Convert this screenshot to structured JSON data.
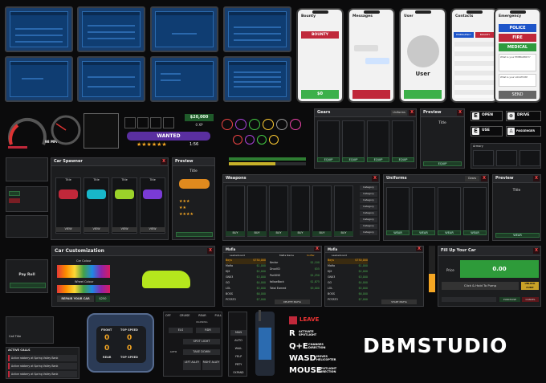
{
  "brand": "DBMSTUDIO",
  "phones": [
    {
      "title": "Bounty",
      "button": "BOUNTY",
      "amount": "$0"
    },
    {
      "title": "Messages"
    },
    {
      "title": "User",
      "name": "User"
    },
    {
      "title": "Contacts",
      "badges": [
        "EMERGENCY",
        "BOUNTY"
      ]
    },
    {
      "title": "Emergency",
      "buttons": [
        "POLICE",
        "FIRE",
        "MEDICAL"
      ],
      "input": "What is your EMERGENCY?",
      "location": "What is your LOCATION?",
      "send": "SEND"
    }
  ],
  "hud": {
    "speed": "98 MPH",
    "money": "$20,000",
    "xp": "0 XP",
    "wanted": "WANTED",
    "timer": "1:56"
  },
  "gears": {
    "title": "Gears",
    "uniform_btn": "Uniforms",
    "equip": [
      "EQUIP",
      "EQUIP",
      "EQUIP",
      "EQUIP"
    ]
  },
  "preview1": {
    "title": "Preview",
    "subtitle": "Title",
    "equip": "EQUIP"
  },
  "keys": [
    {
      "key": "E",
      "label": "OPEN"
    },
    {
      "key": "E",
      "label": "USE"
    },
    {
      "label": "DRIVE"
    },
    {
      "label": "PASSENGER"
    }
  ],
  "armory": {
    "title": "Armory"
  },
  "car_spawner": {
    "title": "Car Spawner",
    "cars": [
      "Title",
      "Title",
      "Title",
      "Title"
    ],
    "view": [
      "VIEW",
      "VIEW",
      "VIEW",
      "VIEW"
    ]
  },
  "preview2": {
    "title": "Preview",
    "subtitle": "Title"
  },
  "weapons": {
    "title": "Weapons",
    "buy": [
      "BUY",
      "BUY",
      "BUY",
      "BUY",
      "BUY",
      "BUY"
    ],
    "category": [
      "Category",
      "Category",
      "Category",
      "Category",
      "Category",
      "Category",
      "Category",
      "Category"
    ]
  },
  "uniforms": {
    "title": "Uniforms",
    "gears_btn": "Gears",
    "wear": [
      "WEAR",
      "WEAR",
      "WEAR",
      "WEAR"
    ]
  },
  "preview3": {
    "title": "Preview",
    "subtitle": "Title",
    "wear": "WEAR"
  },
  "car_custom": {
    "title": "Car Customization",
    "color_picker": "Car Colour",
    "wheel_color": "Wheel Colour",
    "repair": "REPAIR YOUR CAR",
    "price": "$250"
  },
  "mafia": {
    "title": "Mafia",
    "leaderboard": "Leaderboard",
    "name_label": "Mafia Name",
    "sniffer": "Sniffer",
    "rows": [
      [
        "Boys",
        "$750,000"
      ],
      [
        "Mafia",
        "$1,000"
      ],
      [
        "KJX",
        "$2,000"
      ],
      [
        "GNX3",
        "$3,000"
      ],
      [
        "GO",
        "$4,000"
      ],
      [
        "LOL",
        "$5,000"
      ],
      [
        "BOSS",
        "$6,000"
      ],
      [
        "POTATO",
        "$7,000"
      ]
    ],
    "members": [
      [
        "Kevlar",
        "$1,100"
      ],
      [
        "DruxVD",
        "$55"
      ],
      [
        "ParlXNS",
        "$1,250"
      ],
      [
        "fallowBack",
        "$1,875"
      ]
    ],
    "total": "Total Earned",
    "total_val": "$5,000",
    "delete": "DELETE MAFIA",
    "start": "START MAFIA"
  },
  "fuel": {
    "title": "Fill Up Your Car",
    "price_label": "Price",
    "price": "0.00",
    "hold": "Click & Hold To Pump",
    "unlock": "UNLOCK PUMP",
    "purchase": "PURCHASE",
    "cancel": "CANCEL"
  },
  "car_hud": {
    "front": "FRONT",
    "rear": "REAR",
    "top_speed": "TOP SPEED",
    "vals": [
      "0",
      "0",
      "0",
      "0"
    ]
  },
  "siren": {
    "modes": [
      "OFF",
      "CRUISE",
      "REAR",
      "FULL"
    ],
    "warning": "WARNING",
    "els": "ELS",
    "rdr": "RDR",
    "spot": "SPOT LIGHT",
    "take": "TAKE DOWN",
    "left": "LEFT ALLEY",
    "right": "RIGHT ALLEY",
    "auto": "AUTO",
    "side": [
      "MAN",
      "AUTO",
      "WAIL",
      "YELP",
      "PRTY",
      "EXPAND"
    ]
  },
  "heli_keys": [
    {
      "key": "LEAVE",
      "desc": ""
    },
    {
      "key": "R",
      "desc": "ACTIVATE SPOTLIGHT"
    },
    {
      "key": "Q+E",
      "desc": "CHANGES DIRECTION"
    },
    {
      "key": "WASD",
      "desc": "MOVES HELICOPTER"
    },
    {
      "key": "MOUSE",
      "desc": "SPOTLIGHT DIRECTION"
    }
  ],
  "active_calls": {
    "title": "ACTIVE CALLS",
    "items": [
      "Active robbery at Spring Valley Bank",
      "Active robbery at Spring Valley Bank",
      "Active robbery at Spring Valley Bank"
    ]
  },
  "left_panels": {
    "pay_roll": "Pay Roll",
    "call_title": "Call Title"
  }
}
